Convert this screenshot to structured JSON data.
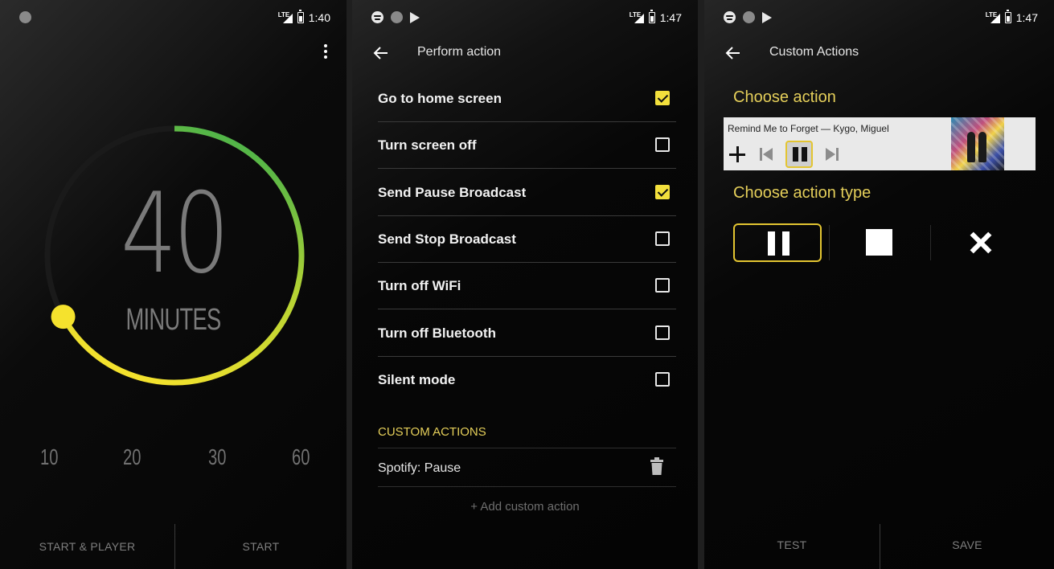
{
  "screen1": {
    "status": {
      "time": "1:40",
      "network": "LTE"
    },
    "timer": {
      "value": "40",
      "unit": "MINUTES",
      "progress": 0.67
    },
    "presets": [
      "10",
      "20",
      "30",
      "60"
    ],
    "buttons": {
      "start_player": "START & PLAYER",
      "start": "START"
    },
    "colors": {
      "arc_start": "#48b24a",
      "arc_end": "#f5e22d",
      "knob": "#f5e22d"
    }
  },
  "screen2": {
    "status": {
      "time": "1:47",
      "network": "LTE"
    },
    "title": "Perform action",
    "actions": [
      {
        "label": "Go to home screen",
        "checked": true
      },
      {
        "label": "Turn screen off",
        "checked": false
      },
      {
        "label": "Send Pause Broadcast",
        "checked": true
      },
      {
        "label": "Send Stop Broadcast",
        "checked": false
      },
      {
        "label": "Turn off WiFi",
        "checked": false
      },
      {
        "label": "Turn off Bluetooth",
        "checked": false
      },
      {
        "label": "Silent mode",
        "checked": false
      }
    ],
    "custom_header": "CUSTOM ACTIONS",
    "custom_actions": [
      {
        "label": "Spotify: Pause"
      }
    ],
    "add_label": "+ Add custom action",
    "accent": "#f3e03c"
  },
  "screen3": {
    "status": {
      "time": "1:47",
      "network": "LTE"
    },
    "title": "Custom Actions",
    "choose_action": "Choose action",
    "notification": {
      "title": "Remind Me to Forget — Kygo, Miguel"
    },
    "choose_type": "Choose action type",
    "action_types": [
      "pause-icon",
      "stop-icon",
      "close-icon"
    ],
    "selected_type": "pause-icon",
    "buttons": {
      "test": "TEST",
      "save": "SAVE"
    }
  }
}
